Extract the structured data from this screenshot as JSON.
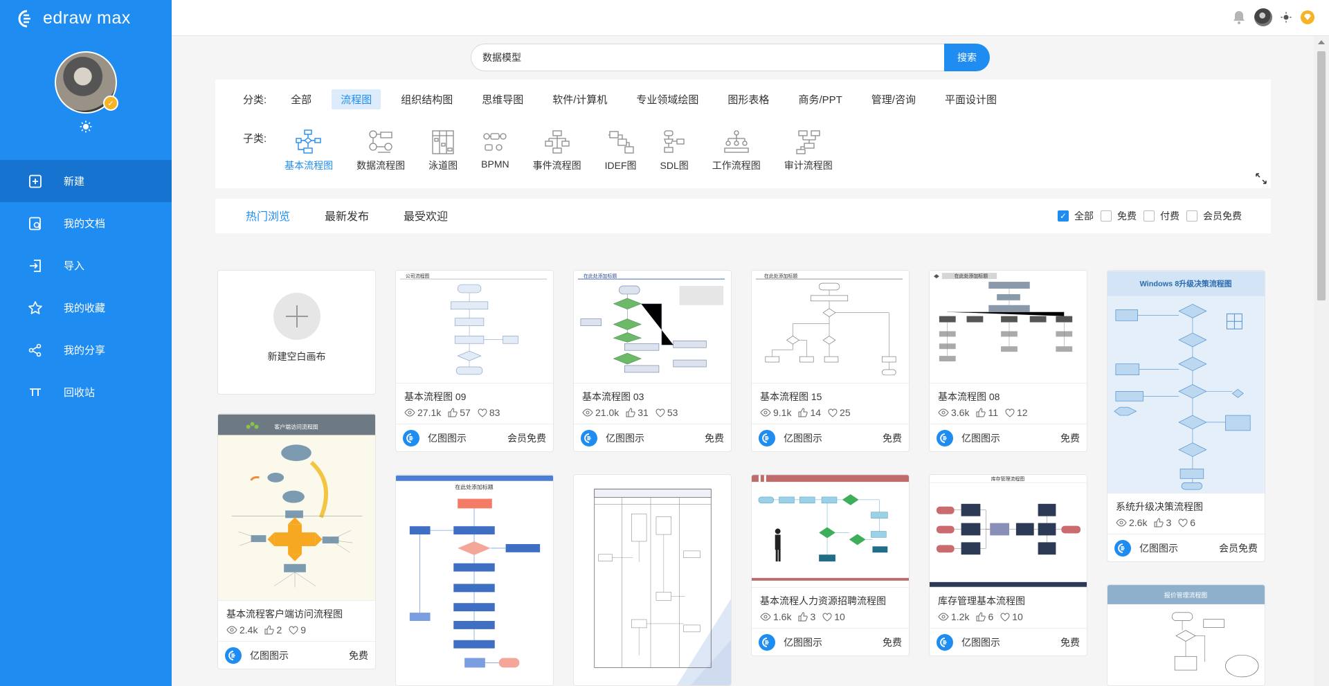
{
  "app": {
    "logo_text": "edraw max"
  },
  "sidebar": {
    "items": [
      {
        "label": "新建",
        "icon": "new-file-icon"
      },
      {
        "label": "我的文档",
        "icon": "documents-icon"
      },
      {
        "label": "导入",
        "icon": "import-icon"
      },
      {
        "label": "我的收藏",
        "icon": "star-icon"
      },
      {
        "label": "我的分享",
        "icon": "share-icon"
      },
      {
        "label": "回收站",
        "icon": "recycle-bin-icon"
      }
    ]
  },
  "search": {
    "value": "数据模型",
    "button": "搜索"
  },
  "categories": {
    "label": "分类:",
    "items": [
      "全部",
      "流程图",
      "组织结构图",
      "思维导图",
      "软件/计算机",
      "专业领域绘图",
      "图形表格",
      "商务/PPT",
      "管理/咨询",
      "平面设计图"
    ],
    "active": "流程图"
  },
  "subcategories": {
    "label": "子类:",
    "items": [
      "基本流程图",
      "数据流程图",
      "泳道图",
      "BPMN",
      "事件流程图",
      "IDEF图",
      "SDL图",
      "工作流程图",
      "审计流程图"
    ],
    "active": "基本流程图"
  },
  "sort": {
    "tabs": [
      "热门浏览",
      "最新发布",
      "最受欢迎"
    ],
    "active": "热门浏览"
  },
  "price_filters": [
    {
      "label": "全部",
      "checked": true
    },
    {
      "label": "免费",
      "checked": false
    },
    {
      "label": "付费",
      "checked": false
    },
    {
      "label": "会员免费",
      "checked": false
    }
  ],
  "new_canvas": {
    "label": "新建空白画布"
  },
  "author_name": "亿图图示",
  "cards": [
    {
      "title": "基本流程图 09",
      "views": "27.1k",
      "likes": "57",
      "favs": "83",
      "price": "会员免费",
      "thumb_title": "公司流程图"
    },
    {
      "title": "基本流程图 03",
      "views": "21.0k",
      "likes": "31",
      "favs": "53",
      "price": "免费",
      "thumb_title": "在此处添加标题"
    },
    {
      "title": "基本流程图 15",
      "views": "9.1k",
      "likes": "14",
      "favs": "25",
      "price": "免费",
      "thumb_title": "在此处添加标题"
    },
    {
      "title": "基本流程图 08",
      "views": "3.6k",
      "likes": "11",
      "favs": "12",
      "price": "免费",
      "thumb_title": "在此处添加标题"
    },
    {
      "title": "系统升级决策流程图",
      "views": "2.6k",
      "likes": "3",
      "favs": "6",
      "price": "会员免费",
      "thumb_title": "Windows 8升级决策流程图"
    },
    {
      "title": "基本流程客户端访问流程图",
      "views": "2.4k",
      "likes": "2",
      "favs": "9",
      "price": "免费",
      "thumb_title": "客户端访问流程图"
    },
    {
      "title": "基本流程人力资源招聘流程图",
      "views": "1.6k",
      "likes": "3",
      "favs": "10",
      "price": "免费",
      "thumb_title": ""
    },
    {
      "title": "库存管理基本流程图",
      "views": "1.2k",
      "likes": "6",
      "favs": "10",
      "price": "免费",
      "thumb_title": "库存管理流程图"
    }
  ],
  "partial_cards": [
    {
      "thumb_title": "在此处添加标题"
    },
    {
      "thumb_title": ""
    },
    {
      "thumb_title": "报价管理流程图"
    }
  ],
  "colors": {
    "sidebar": "#1f8cf2",
    "sidebar_active": "#1673cf",
    "accent": "#1f8cf2"
  }
}
